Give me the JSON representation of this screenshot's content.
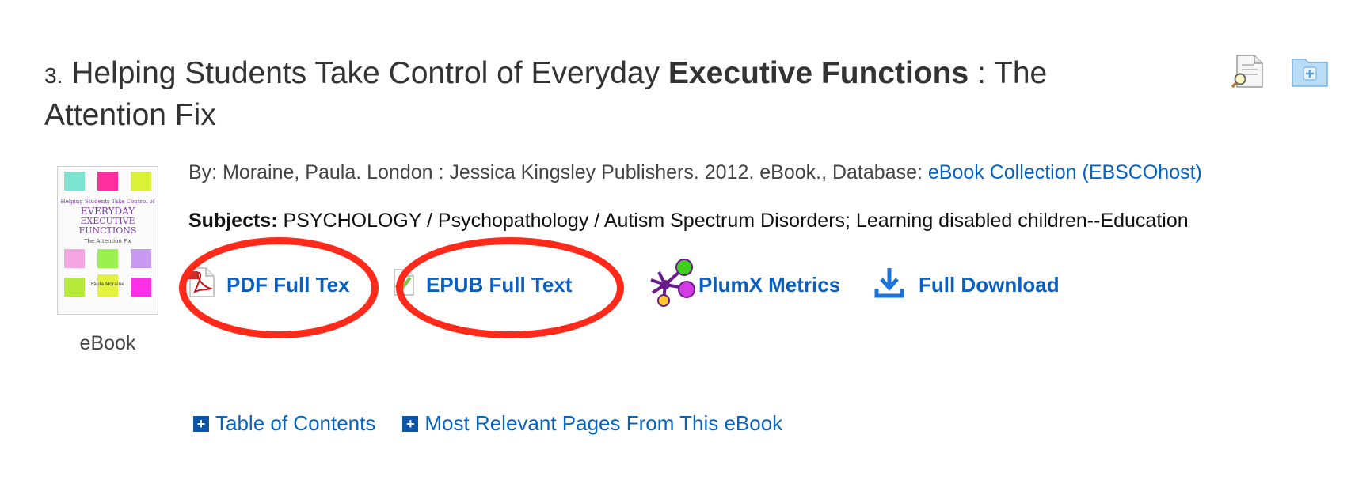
{
  "result": {
    "number": "3.",
    "title_before": "Helping Students Take Control of Everyday",
    "title_bold": "Executive Functions",
    "title_after": ": The Attention Fix",
    "format": "eBook",
    "details_prefix": "By: Moraine, Paula. London : Jessica Kingsley Publishers. 2012. eBook., Database:",
    "database": "eBook Collection (EBSCOhost)",
    "subjects_label": "Subjects:",
    "subjects_text": "PSYCHOLOGY / Psychopathology / Autism Spectrum Disorders; Learning disabled children--Education",
    "cover": {
      "title_line1": "Helping Students Take Control of",
      "title_line2": "EVERYDAY",
      "title_line3": "EXECUTIVE",
      "title_line4": "FUNCTIONS",
      "subtitle": "The Attention Fix",
      "author": "Paula Moraine"
    }
  },
  "links": {
    "pdf": "PDF Full Tex",
    "epub": "EPUB Full Text",
    "plumx": "PlumX Metrics",
    "download": "Full Download"
  },
  "bottom": {
    "toc": "Table of Contents",
    "relevant": "Most Relevant Pages From This eBook"
  },
  "colors": {
    "link": "#0b5fc2",
    "annotation": "#ff2a1a",
    "plus_box": "#0a55a8"
  }
}
